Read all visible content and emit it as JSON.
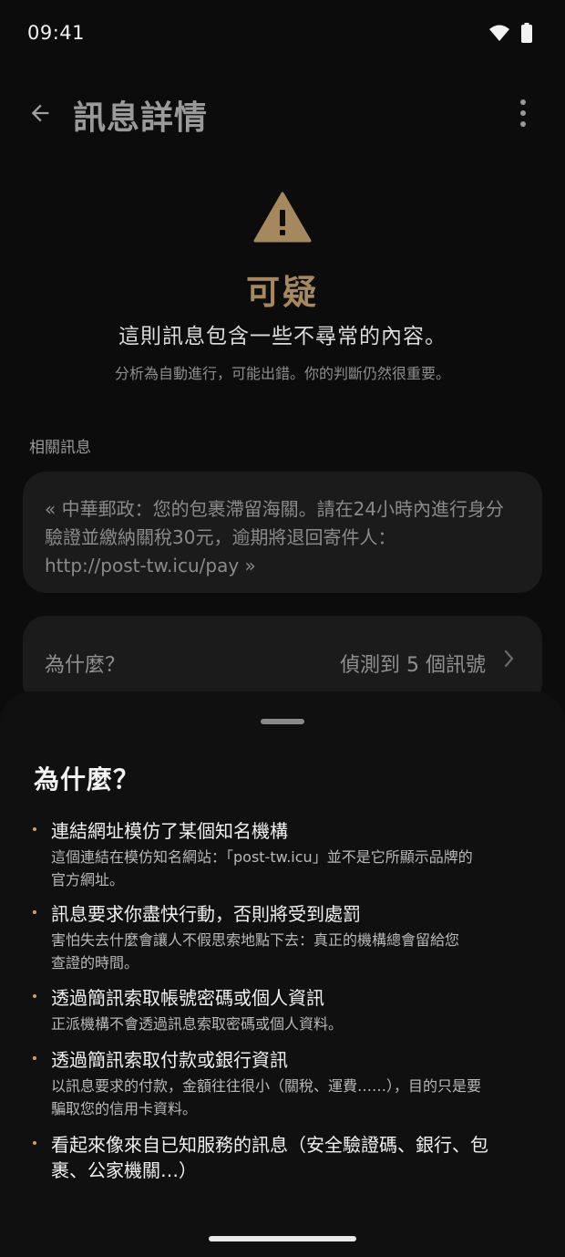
{
  "status_bar": {
    "time": "09:41"
  },
  "header": {
    "title": "訊息詳情"
  },
  "verdict": {
    "label": "可疑",
    "subtitle": "這則訊息包含一些不尋常的內容。",
    "note": "分析為自動進行，可能出錯。你的判斷仍然很重要。"
  },
  "related": {
    "section_label": "相關訊息",
    "message_line1": "« 中華郵政：您的包裹滯留海關。請在24小時內進行身分",
    "message_line2": "驗證並繳納關稅30元，逾期將退回寄件人：",
    "message_line3": "http://post-tw.icu/pay »"
  },
  "why_row": {
    "label": "為什麼？",
    "summary": "偵測到 5 個訊號"
  },
  "sheet": {
    "title": "為什麼？",
    "reasons": [
      {
        "title": "連結網址模仿了某個知名機構",
        "desc_line1": "這個連結在模仿知名網站：「post-tw.icu」並不是它所顯示品牌的",
        "desc_line2": "官方網址。"
      },
      {
        "title": "訊息要求你盡快行動，否則將受到處罰",
        "desc_line1": "害怕失去什麼會讓人不假思索地點下去：真正的機構總會留給您",
        "desc_line2": "查證的時間。"
      },
      {
        "title": "透過簡訊索取帳號密碼或個人資訊",
        "desc_line1": "正派機構不會透過訊息索取密碼或個人資料。",
        "desc_line2": ""
      },
      {
        "title": "透過簡訊索取付款或銀行資訊",
        "desc_line1": "以訊息要求的付款，金額往往很小（關稅、運費……），目的只是要",
        "desc_line2": "騙取您的信用卡資料。"
      },
      {
        "title_line1": "看起來像來自已知服務的訊息（安全驗證碼、銀行、包",
        "title_line2": "裹、公家機關…）"
      }
    ]
  },
  "colors": {
    "accent": "#a6885d",
    "bullet": "#c9a46b",
    "card": "#1b1b1b",
    "background": "#0c0c0c"
  }
}
